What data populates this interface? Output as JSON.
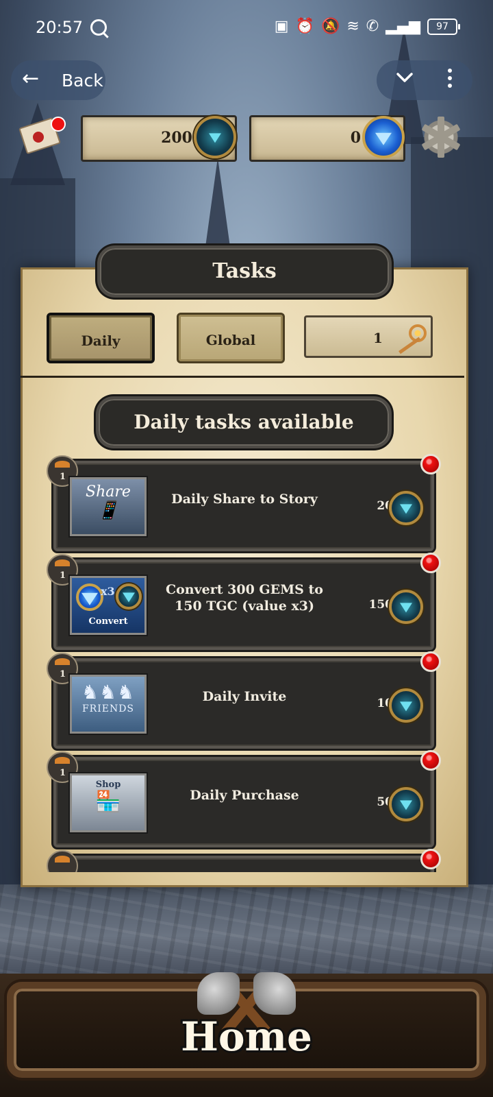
{
  "status_bar": {
    "time": "20:57",
    "battery": "97",
    "icons": [
      "search-icon",
      "nfc-icon",
      "alarm-icon",
      "mute-icon",
      "wifi-icon",
      "wifi-call-icon",
      "signal-icon",
      "battery-icon"
    ]
  },
  "nav": {
    "back_label": "Back",
    "back_icon": "arrow-left-icon",
    "collapse_icon": "chevron-down-icon",
    "more_icon": "more-vertical-icon"
  },
  "resources": {
    "tgc_amount": "200",
    "gems_amount": "0"
  },
  "panel": {
    "title": "Tasks",
    "tabs": [
      {
        "label": "Daily",
        "selected": true
      },
      {
        "label": "Global",
        "selected": false
      }
    ],
    "keys_count": "1",
    "subtitle": "Daily tasks available"
  },
  "tasks": [
    {
      "name": "Daily Share to Story",
      "reward": "20",
      "level": "1",
      "thumb_text": "Share"
    },
    {
      "name": "Convert 300 GEMS to 150 TGC (value x3)",
      "reward": "150",
      "level": "1",
      "thumb_text": "Convert",
      "thumb_badge": "x3"
    },
    {
      "name": "Daily Invite",
      "reward": "10",
      "level": "1",
      "thumb_text": "FRIENDS"
    },
    {
      "name": "Daily Purchase",
      "reward": "50",
      "level": "1",
      "thumb_text": "Shop"
    }
  ],
  "footer": {
    "home_label": "Home"
  },
  "colors": {
    "panel_parchment": "#e8d7ad",
    "banner_dark": "#2b2a27",
    "task_bg": "#2b2a28",
    "notification_red": "#e11111",
    "tgc_teal": "#2d8a9e",
    "gem_blue": "#1b5fd1"
  }
}
